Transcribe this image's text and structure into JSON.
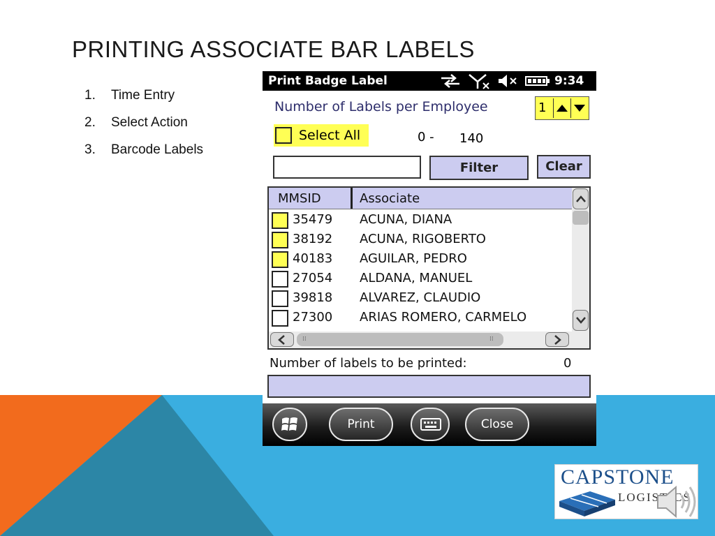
{
  "slide": {
    "title": "PRINTING ASSOCIATE BAR LABELS",
    "steps": [
      {
        "num": "1.",
        "text": "Time Entry"
      },
      {
        "num": "2.",
        "text": "Select  Action"
      },
      {
        "num": "3.",
        "text": "Barcode Labels"
      }
    ],
    "colors": {
      "orange": "#f26b1d",
      "blue": "#3aaee0",
      "teal": "#2c86a6"
    }
  },
  "device": {
    "status_bar": {
      "app_title": "Print Badge Label",
      "time": "9:34",
      "icons": [
        "sync-arrows-icon",
        "no-signal-icon",
        "speaker-muted-icon",
        "battery-icon"
      ]
    },
    "labels_per_employee": {
      "label": "Number of Labels per Employee",
      "value": "1",
      "icons": [
        "arrow-up-icon",
        "arrow-down-icon"
      ]
    },
    "select_all_label": "Select All",
    "range": {
      "from": "0 -",
      "to": "140"
    },
    "filter_input": {
      "value": "",
      "placeholder": ""
    },
    "filter_button": "Filter",
    "clear_button": "Clear",
    "table": {
      "headers": [
        "MMSID",
        "Associate"
      ],
      "rows": [
        {
          "id": "35479",
          "name": "ACUNA, DIANA",
          "highlight": true
        },
        {
          "id": "38192",
          "name": "ACUNA, RIGOBERTO",
          "highlight": true
        },
        {
          "id": "40183",
          "name": "AGUILAR, PEDRO",
          "highlight": true
        },
        {
          "id": "27054",
          "name": "ALDANA, MANUEL",
          "highlight": false
        },
        {
          "id": "39818",
          "name": "ALVAREZ, CLAUDIO",
          "highlight": false
        },
        {
          "id": "27300",
          "name": "ARIAS ROMERO, CARMELO",
          "highlight": false
        }
      ]
    },
    "labels_to_print": {
      "label": "Number of labels to be printed:",
      "count": "0"
    },
    "taskbar": {
      "windows_icon": "windows-logo-icon",
      "print_label": "Print",
      "keyboard_icon": "keyboard-icon",
      "close_label": "Close"
    }
  },
  "logo": {
    "brand": "CAPSTONE",
    "sub": "LOGISTICS"
  }
}
